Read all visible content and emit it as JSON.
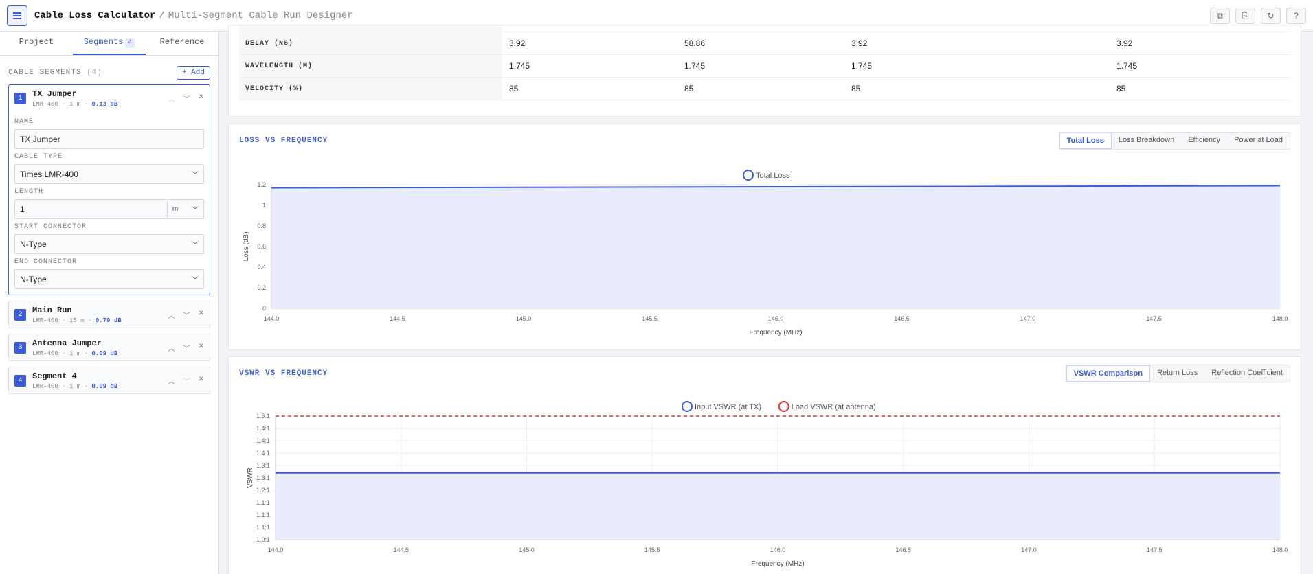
{
  "header": {
    "title": "Cable Loss Calculator",
    "separator": "/",
    "subtitle": "Multi-Segment Cable Run Designer"
  },
  "sidebar": {
    "tabs": [
      {
        "label": "Project"
      },
      {
        "label": "Segments",
        "badge": "4"
      },
      {
        "label": "Reference"
      }
    ],
    "section_label": "CABLE SEGMENTS",
    "section_count": "(4)",
    "add_label": "+ Add",
    "segments": [
      {
        "num": "1",
        "name": "TX Jumper",
        "meta": "LMR-400 · 1 m ·",
        "db": "0.13 dB"
      },
      {
        "num": "2",
        "name": "Main Run",
        "meta": "LMR-400 · 15 m ·",
        "db": "0.79 dB"
      },
      {
        "num": "3",
        "name": "Antenna Jumper",
        "meta": "LMR-400 · 1 m ·",
        "db": "0.09 dB"
      },
      {
        "num": "4",
        "name": "Segment 4",
        "meta": "LMR-400 · 1 m ·",
        "db": "0.09 dB"
      }
    ],
    "form": {
      "name_label": "NAME",
      "name_value": "TX Jumper",
      "cable_label": "CABLE TYPE",
      "cable_value": "Times LMR-400",
      "length_label": "LENGTH",
      "length_value": "1",
      "length_unit": "m",
      "start_label": "START CONNECTOR",
      "start_value": "N-Type",
      "end_label": "END CONNECTOR",
      "end_value": "N-Type"
    }
  },
  "table": {
    "rows": [
      {
        "key": "DELAY (NS)",
        "values": [
          "3.92",
          "58.86",
          "3.92",
          "3.92"
        ]
      },
      {
        "key": "WAVELENGTH (M)",
        "values": [
          "1.745",
          "1.745",
          "1.745",
          "1.745"
        ]
      },
      {
        "key": "VELOCITY (%)",
        "values": [
          "85",
          "85",
          "85",
          "85"
        ]
      }
    ]
  },
  "loss_panel": {
    "title": "LOSS VS FREQUENCY",
    "tabs": [
      "Total Loss",
      "Loss Breakdown",
      "Efficiency",
      "Power at Load"
    ],
    "active_tab": 0
  },
  "vswr_panel": {
    "title": "VSWR VS FREQUENCY",
    "tabs": [
      "VSWR Comparison",
      "Return Loss",
      "Reflection Coefficient"
    ],
    "active_tab": 0
  },
  "colors": {
    "accent": "#3b5bdb",
    "limit": "#e03131",
    "fill": "#e5e9fc"
  },
  "chart_data": [
    {
      "type": "area",
      "title": "",
      "xlabel": "Frequency (MHz)",
      "ylabel": "Loss (dB)",
      "xlim": [
        144,
        148
      ],
      "ylim": [
        0,
        1.2
      ],
      "x_ticks": [
        "144.0",
        "144.5",
        "145.0",
        "145.5",
        "146.0",
        "146.5",
        "147.0",
        "147.5",
        "148.0"
      ],
      "y_ticks": [
        "0",
        "0.2",
        "0.4",
        "0.6",
        "0.8",
        "1",
        "1.2"
      ],
      "grid": true,
      "legend": "top-center",
      "series": [
        {
          "name": "Total Loss",
          "x": [
            144,
            145,
            146,
            147,
            148
          ],
          "values": [
            1.17,
            1.175,
            1.18,
            1.185,
            1.19
          ]
        }
      ]
    },
    {
      "type": "line",
      "title": "",
      "xlabel": "Frequency (MHz)",
      "ylabel": "VSWR",
      "xlim": [
        144,
        148
      ],
      "ylim": [
        1.0,
        1.5
      ],
      "x_ticks": [
        "144.0",
        "144.5",
        "145.0",
        "145.5",
        "146.0",
        "146.5",
        "147.0",
        "147.5",
        "148.0"
      ],
      "y_ticks": [
        "1.0:1",
        "1.1:1",
        "1.1:1",
        "1.1:1",
        "1.2:1",
        "1.3:1",
        "1.3:1",
        "1.4:1",
        "1.4:1",
        "1.4:1",
        "1.5:1"
      ],
      "grid": true,
      "legend": "top-center",
      "series": [
        {
          "name": "Input VSWR (at TX)",
          "x": [
            144,
            145,
            146,
            147,
            148
          ],
          "values": [
            1.27,
            1.27,
            1.27,
            1.27,
            1.27
          ]
        },
        {
          "name": "Load VSWR (at antenna)",
          "x": [
            144,
            148
          ],
          "values": [
            1.5,
            1.5
          ]
        }
      ]
    }
  ]
}
